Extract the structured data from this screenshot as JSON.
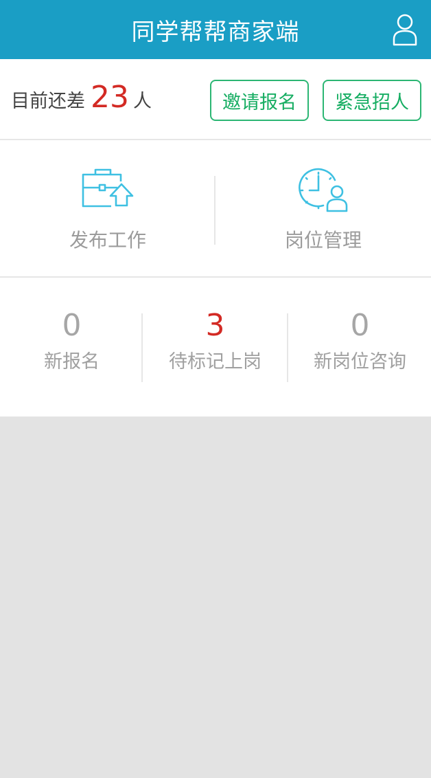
{
  "header": {
    "title": "同学帮帮商家端",
    "user_icon": "user-icon"
  },
  "need": {
    "prefix": "目前还差",
    "count": "23",
    "suffix": "人",
    "invite_label": "邀请报名",
    "urgent_label": "紧急招人"
  },
  "actions": [
    {
      "label": "发布工作",
      "icon": "briefcase-upload-icon"
    },
    {
      "label": "岗位管理",
      "icon": "clock-person-icon"
    }
  ],
  "stats": [
    {
      "value": "0",
      "label": "新报名"
    },
    {
      "value": "3",
      "label": "待标记上岗"
    },
    {
      "value": "0",
      "label": "新岗位咨询"
    }
  ],
  "colors": {
    "header_bg": "#1a9ec5",
    "accent_green": "#16ad62",
    "alert_red": "#d32a24",
    "icon_cyan": "#3ec0e2",
    "page_bg": "#e3e3e3"
  }
}
